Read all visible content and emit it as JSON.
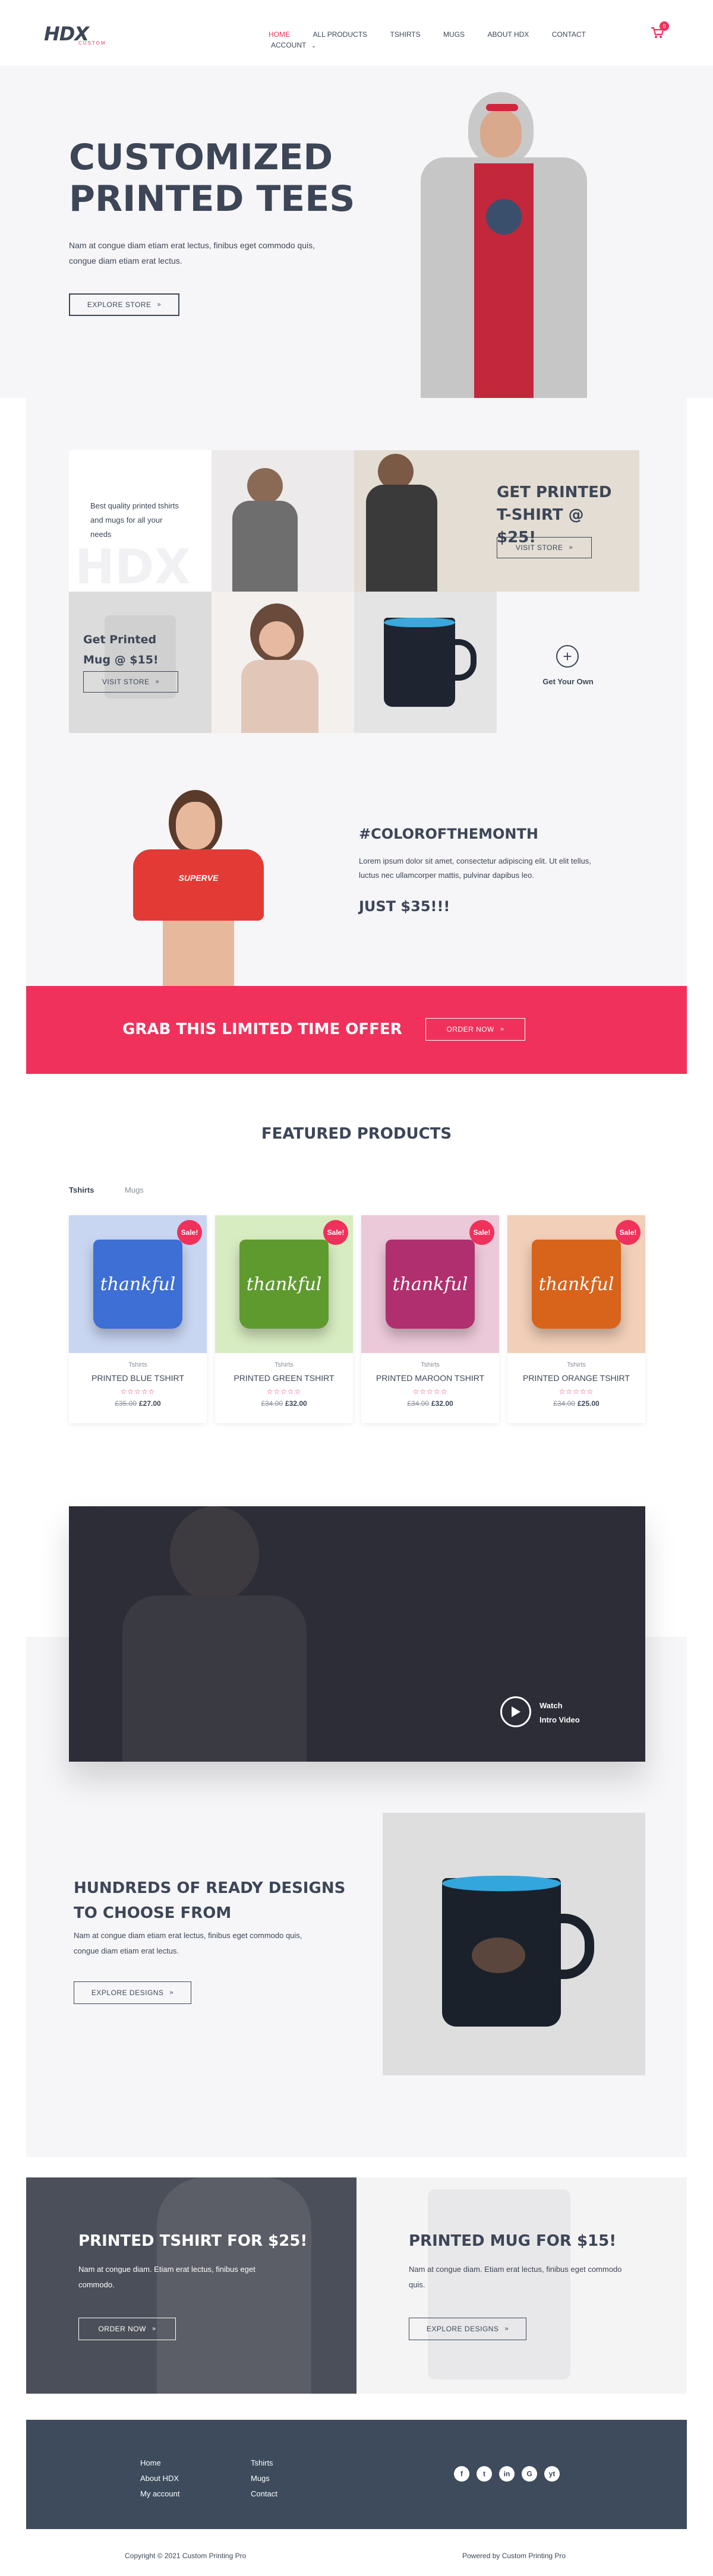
{
  "brand": {
    "logo_text": "HDX",
    "logo_sub": "CUSTOM",
    "accent": "#f0315b",
    "dark": "#3d4657"
  },
  "header": {
    "nav": [
      "HOME",
      "ALL PRODUCTS",
      "TSHIRTS",
      "MUGS",
      "ABOUT HDX",
      "CONTACT",
      "ACCOUNT"
    ],
    "cart_count": "0"
  },
  "hero": {
    "title_line1": "CUSTOMIZED",
    "title_line2": "PRINTED TEES",
    "text": "Nam at congue diam etiam erat lectus, finibus eget commodo quis, congue diam etiam erat lectus.",
    "button": "EXPLORE STORE"
  },
  "grid": {
    "intro_text": "Best quality printed tshirts and mugs for all your needs",
    "tshirt_title": "GET PRINTED T-SHIRT @ $25!",
    "tshirt_button": "VISIT STORE",
    "mug_title": "Get Printed Mug @ $15!",
    "mug_button": "VISIT STORE",
    "own_label": "Get Your Own"
  },
  "color_month": {
    "title": "#COLOROFTHEMONTH",
    "text": "Lorem ipsum dolor sit amet, consectetur adipiscing elit. Ut elit tellus, luctus nec ullamcorper mattis, pulvinar dapibus leo.",
    "price": "JUST $35!!!",
    "shirt_print": "SUPERVE"
  },
  "offer": {
    "title": "GRAB THIS LIMITED TIME OFFER",
    "button": "ORDER NOW"
  },
  "featured": {
    "title": "FEATURED PRODUCTS",
    "tabs": [
      "Tshirts",
      "Mugs"
    ],
    "products": [
      {
        "name": "PRINTED BLUE TSHIRT",
        "category": "Tshirts",
        "old_price": "£35.00",
        "price": "£27.00",
        "sale": "Sale!",
        "print": "thankful",
        "bg": "#c9d6f2",
        "shirt": "#3d6fd4"
      },
      {
        "name": "PRINTED GREEN TSHIRT",
        "category": "Tshirts",
        "old_price": "£34.00",
        "price": "£32.00",
        "sale": "Sale!",
        "print": "thankful",
        "bg": "#d8ecc2",
        "shirt": "#5f9a2f"
      },
      {
        "name": "PRINTED MAROON TSHIRT",
        "category": "Tshirts",
        "old_price": "£34.00",
        "price": "£32.00",
        "sale": "Sale!",
        "print": "thankful",
        "bg": "#ecc9d8",
        "shirt": "#b02f6e"
      },
      {
        "name": "PRINTED ORANGE TSHIRT",
        "category": "Tshirts",
        "old_price": "£34.00",
        "price": "£25.00",
        "sale": "Sale!",
        "print": "thankful",
        "bg": "#f1cfb8",
        "shirt": "#d8631a"
      }
    ]
  },
  "video": {
    "label_line1": "Watch",
    "label_line2": "Intro Video"
  },
  "designs": {
    "title_line1": "HUNDREDS OF READY DESIGNS",
    "title_line2": "TO CHOOSE FROM",
    "text": "Nam at congue diam etiam erat lectus, finibus eget commodo quis, congue diam etiam erat lectus.",
    "button": "EXPLORE DESIGNS"
  },
  "promo": {
    "tshirt_title": "PRINTED TSHIRT FOR $25!",
    "tshirt_text": "Nam at congue diam. Etiam erat lectus, finibus eget commodo.",
    "tshirt_button": "ORDER NOW",
    "mug_title": "PRINTED MUG FOR $15!",
    "mug_text": "Nam at congue diam. Etiam erat lectus, finibus eget commodo quis.",
    "mug_button": "EXPLORE DESIGNS"
  },
  "footer": {
    "col1": [
      "Home",
      "About HDX",
      "My account"
    ],
    "col2": [
      "Tshirts",
      "Mugs",
      "Contact"
    ],
    "social_icons": [
      "f",
      "t",
      "in",
      "G",
      "yt"
    ],
    "copyright": "Copyright © 2021 Custom Printing Pro",
    "powered": "Powered by Custom Printing Pro"
  }
}
